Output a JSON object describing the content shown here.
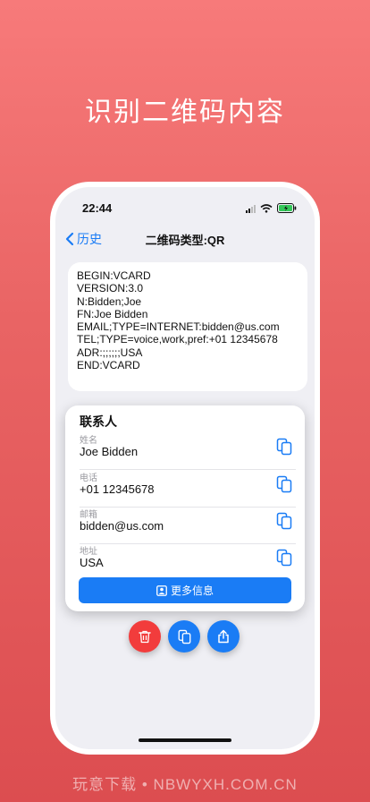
{
  "headline": "识别二维码内容",
  "status": {
    "time": "22:44"
  },
  "nav": {
    "back_label": "历史",
    "title": "二维码类型:QR"
  },
  "raw_content": [
    "BEGIN:VCARD",
    "VERSION:3.0",
    "N:Bidden;Joe",
    "FN:Joe Bidden",
    "EMAIL;TYPE=INTERNET:bidden@us.com",
    "TEL;TYPE=voice,work,pref:+01 12345678",
    "ADR:;;;;;;USA",
    "END:VCARD"
  ],
  "contact": {
    "title": "联系人",
    "fields": [
      {
        "label": "姓名",
        "value": "Joe Bidden"
      },
      {
        "label": "电话",
        "value": "+01 12345678"
      },
      {
        "label": "邮箱",
        "value": "bidden@us.com"
      },
      {
        "label": "地址",
        "value": "USA"
      }
    ],
    "more_label": "更多信息"
  },
  "footer": "玩意下载 • NBWYXH.COM.CN",
  "colors": {
    "accent": "#1a7cf5",
    "danger": "#f23c3c",
    "background": "#e96464"
  },
  "icons": [
    "chevron-left-icon",
    "copy-icon",
    "contact-card-icon",
    "trash-icon",
    "share-icon",
    "signal-icon",
    "wifi-icon",
    "battery-icon"
  ]
}
